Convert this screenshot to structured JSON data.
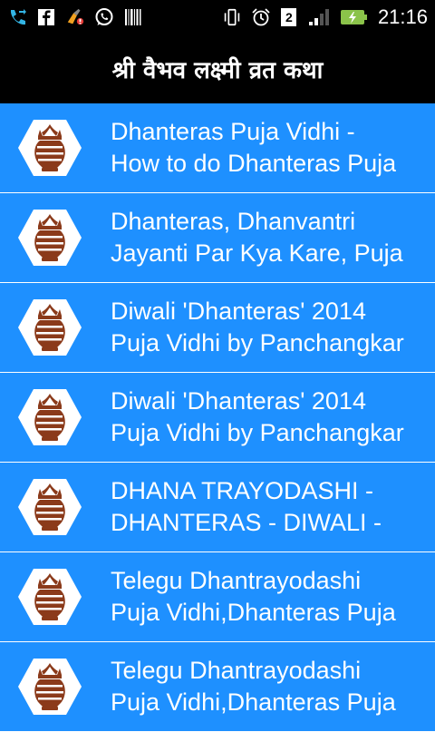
{
  "status_bar": {
    "time": "21:16",
    "icons_left": [
      "call-forward-icon",
      "facebook-icon",
      "cleaner-icon",
      "whatsapp-icon",
      "barcode-icon"
    ],
    "icons_right": [
      "vibrate-icon",
      "alarm-icon",
      "sim-2-icon",
      "signal-icon",
      "battery-charging-icon"
    ],
    "sim_label": "2"
  },
  "header": {
    "title": "श्री वैभव लक्ष्मी व्रत कथा"
  },
  "items": [
    {
      "line1": "Dhanteras Puja Vidhi -",
      "line2": "How to do Dhanteras Puja"
    },
    {
      "line1": "Dhanteras, Dhanvantri",
      "line2": "Jayanti Par Kya Kare, Puja"
    },
    {
      "line1": "Diwali 'Dhanteras' 2014",
      "line2": "Puja Vidhi by Panchangkar"
    },
    {
      "line1": "Diwali 'Dhanteras' 2014",
      "line2": "Puja Vidhi by Panchangkar"
    },
    {
      "line1": "DHANA TRAYODASHI -",
      "line2": "DHANTERAS - DIWALI -"
    },
    {
      "line1": "Telegu Dhantrayodashi",
      "line2": "Puja Vidhi,Dhanteras Puja"
    },
    {
      "line1": "Telegu Dhantrayodashi",
      "line2": "Puja Vidhi,Dhanteras Puja"
    }
  ],
  "colors": {
    "list_bg": "#1e90ff",
    "title_bg": "#000000",
    "divider": "#ffffff",
    "kalash": "#8b3a1a"
  }
}
